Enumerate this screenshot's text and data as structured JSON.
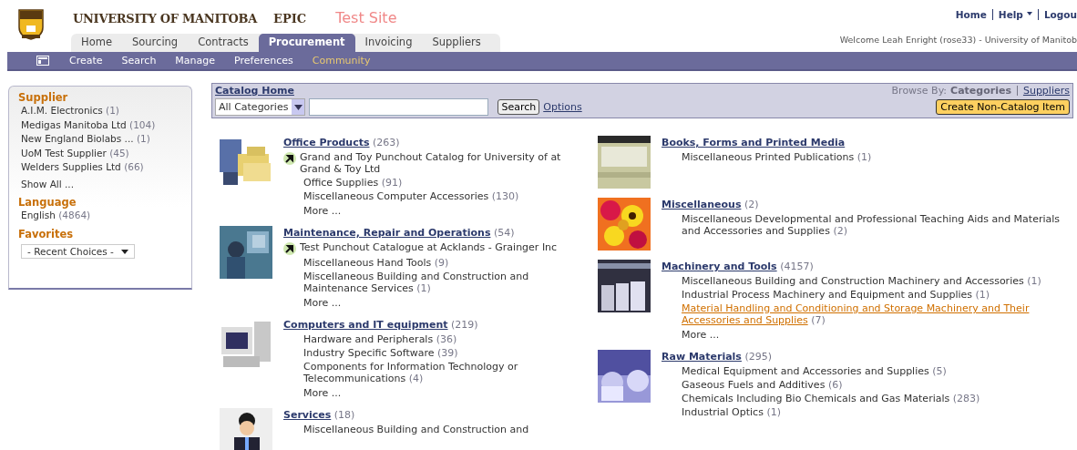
{
  "header": {
    "university": "UNIVERSITY OF MANITOBA",
    "product": "EPIC",
    "site_label": "Test Site",
    "top_links": [
      {
        "label": "Home",
        "caret": false
      },
      {
        "label": "Help",
        "caret": true
      },
      {
        "label": "Logou",
        "caret": false
      }
    ],
    "welcome": "Welcome Leah Enright (rose33) - University of Manitob"
  },
  "tabs": [
    {
      "label": "Home",
      "selected": false
    },
    {
      "label": "Sourcing",
      "selected": false
    },
    {
      "label": "Contracts",
      "selected": false
    },
    {
      "label": "Procurement",
      "selected": true
    },
    {
      "label": "Invoicing",
      "selected": false
    },
    {
      "label": "Suppliers",
      "selected": false
    }
  ],
  "subnav": [
    {
      "label": "Create",
      "selected": false
    },
    {
      "label": "Search",
      "selected": false
    },
    {
      "label": "Manage",
      "selected": false
    },
    {
      "label": "Preferences",
      "selected": false
    },
    {
      "label": "Community",
      "selected": true
    }
  ],
  "sidebar": {
    "sections": [
      {
        "title": "Supplier",
        "items": [
          {
            "label": "A.I.M. Electronics",
            "count": "(1)"
          },
          {
            "label": "Medigas Manitoba Ltd",
            "count": "(104)"
          },
          {
            "label": "New England Biolabs ...",
            "count": "(1)"
          },
          {
            "label": "UoM Test Supplier",
            "count": "(45)"
          },
          {
            "label": "Welders Supplies Ltd",
            "count": "(66)"
          }
        ],
        "show_all": "Show All ..."
      },
      {
        "title": "Language",
        "items": [
          {
            "label": "English",
            "count": "(4864)"
          }
        ]
      },
      {
        "title": "Favorites",
        "dropdown": "- Recent Choices -"
      }
    ]
  },
  "catalog_bar": {
    "title": "Catalog Home",
    "category_select": "All Categories",
    "search_button": "Search",
    "options_link": "Options",
    "browse_by_label": "Browse By:",
    "browse_options": [
      {
        "label": "Categories",
        "selected": true
      },
      {
        "label": "Suppliers",
        "selected": false
      }
    ],
    "create_button": "Create Non-Catalog Item"
  },
  "columns": [
    [
      {
        "title": "Office Products",
        "count": "(263)",
        "items": [
          {
            "kind": "punchout",
            "label": "Grand and Toy Punchout Catalog for University of at Grand & Toy Ltd",
            "highlighted": false
          },
          {
            "kind": "subcategory",
            "label": "Office Supplies",
            "count": "(91)",
            "highlighted": false
          },
          {
            "kind": "subcategory",
            "label": "Miscellaneous Computer Accessories",
            "count": "(130)",
            "highlighted": false
          }
        ],
        "more": "More ..."
      },
      {
        "title": "Maintenance, Repair and Operations",
        "count": "(54)",
        "items": [
          {
            "kind": "punchout",
            "label": "Test Punchout Catalogue at Acklands - Grainger Inc",
            "highlighted": false
          },
          {
            "kind": "subcategory",
            "label": "Miscellaneous Hand Tools",
            "count": "(9)",
            "highlighted": false
          },
          {
            "kind": "subcategory",
            "label": "Miscellaneous Building and Construction and Maintenance Services",
            "count": "(1)",
            "highlighted": false
          }
        ],
        "more": "More ..."
      },
      {
        "title": "Computers and IT equipment",
        "count": "(219)",
        "items": [
          {
            "kind": "subcategory",
            "label": "Hardware and Peripherals",
            "count": "(36)",
            "highlighted": false
          },
          {
            "kind": "subcategory",
            "label": "Industry Specific Software",
            "count": "(39)",
            "highlighted": false
          },
          {
            "kind": "subcategory",
            "label": "Components for Information Technology or Telecommunications",
            "count": "(4)",
            "highlighted": false
          }
        ],
        "more": "More ..."
      },
      {
        "title": "Services",
        "count": "(18)",
        "items": [
          {
            "kind": "subcategory",
            "label": "Miscellaneous Building and Construction and",
            "highlighted": false
          }
        ]
      }
    ],
    [
      {
        "title": "Books, Forms and Printed Media",
        "items": [
          {
            "kind": "subcategory",
            "label": "Miscellaneous Printed Publications",
            "count": "(1)",
            "highlighted": false
          }
        ]
      },
      {
        "title": "Miscellaneous",
        "count": "(2)",
        "items": [
          {
            "kind": "subcategory",
            "label": "Miscellaneous Developmental and Professional Teaching Aids and Materials and Accessories and Supplies",
            "count": "(2)",
            "highlighted": false
          }
        ]
      },
      {
        "title": "Machinery and Tools",
        "count": "(4157)",
        "items": [
          {
            "kind": "subcategory",
            "label": "Miscellaneous Building and Construction Machinery and Accessories",
            "count": "(1)",
            "highlighted": false
          },
          {
            "kind": "subcategory",
            "label": "Industrial Process Machinery and Equipment and Supplies",
            "count": "(1)",
            "highlighted": false
          },
          {
            "kind": "subcategory",
            "label": "Material Handling and Conditioning and Storage Machinery and Their Accessories and Supplies",
            "count": "(7)",
            "highlighted": true
          }
        ],
        "more": "More ..."
      },
      {
        "title": "Raw Materials",
        "count": "(295)",
        "items": [
          {
            "kind": "subcategory",
            "label": "Medical Equipment and Accessories and Supplies",
            "count": "(5)",
            "highlighted": false
          },
          {
            "kind": "subcategory",
            "label": "Gaseous Fuels and Additives",
            "count": "(6)",
            "highlighted": false
          },
          {
            "kind": "subcategory",
            "label": "Chemicals Including Bio Chemicals and Gas Materials",
            "count": "(283)",
            "highlighted": false
          },
          {
            "kind": "subcategory",
            "label": "Industrial Optics",
            "count": "(1)",
            "highlighted": false
          }
        ]
      }
    ]
  ]
}
